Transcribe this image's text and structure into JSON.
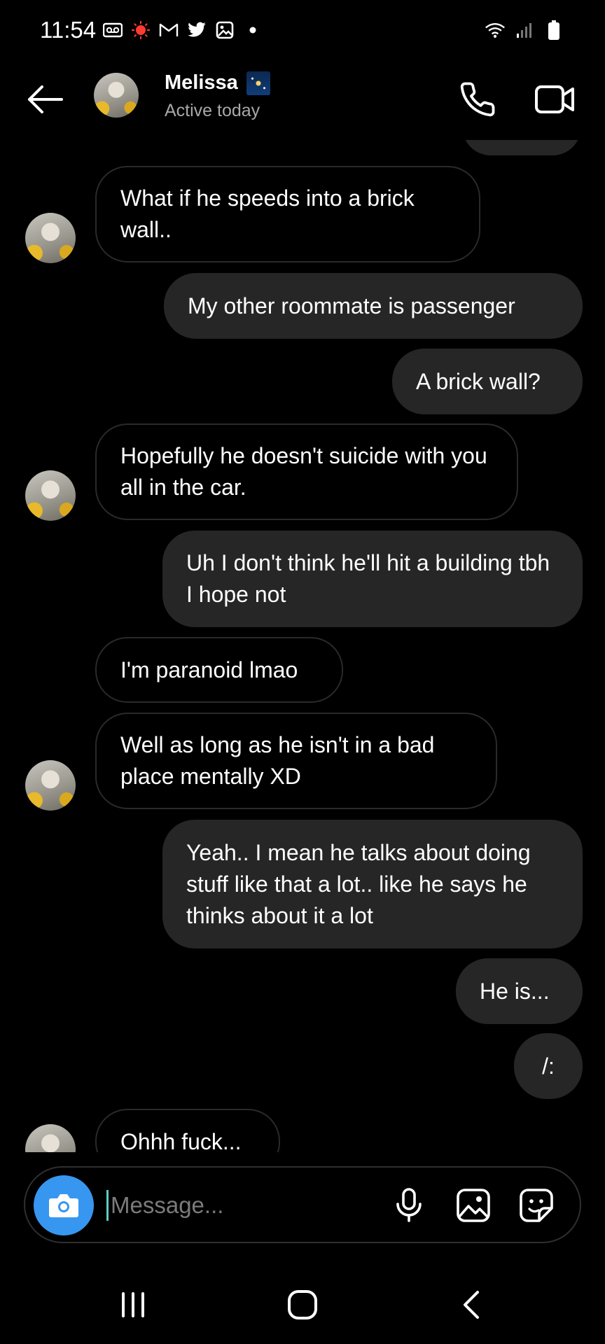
{
  "status_bar": {
    "time": "11:54",
    "left_icons": [
      "voicemail-icon",
      "notification-dot-icon",
      "gmail-icon",
      "twitter-icon",
      "gallery-icon",
      "dot-icon"
    ],
    "right_icons": [
      "wifi-icon",
      "signal-icon",
      "battery-icon"
    ]
  },
  "header": {
    "contact_name": "Melissa",
    "status": "Active today"
  },
  "messages": [
    {
      "side": "in",
      "text": "What if he speeds into a brick wall..",
      "lines": 2
    },
    {
      "side": "out",
      "text": "My other roommate is passenger",
      "lines": 1
    },
    {
      "side": "out",
      "text": "A brick wall?",
      "lines": 1
    },
    {
      "side": "in",
      "text": "Hopefully he doesn't suicide with you all in the car.",
      "lines": 2
    },
    {
      "side": "out",
      "text": "Uh I don't think he'll hit a building tbh I hope not",
      "lines": 2
    },
    {
      "side": "in",
      "text": "I'm paranoid lmao",
      "lines": 1
    },
    {
      "side": "in",
      "text": "Well as long as he isn't in a bad place mentally XD",
      "lines": 2
    },
    {
      "side": "out",
      "text": "Yeah.. I mean he talks about doing stuff like that a lot.. like he says he thinks about it a lot",
      "lines": 3
    },
    {
      "side": "out",
      "text": "He is...",
      "lines": 1
    },
    {
      "side": "out",
      "text": "/:",
      "lines": 1
    },
    {
      "side": "in",
      "text": "Ohhh fuck...",
      "lines": 1
    }
  ],
  "composer": {
    "placeholder": "Message..."
  },
  "colors": {
    "background": "#000000",
    "outgoing_bubble": "#262626",
    "incoming_border": "#2a2a2a",
    "camera_button": "#3797f0",
    "muted_text": "#a8a8a8"
  }
}
